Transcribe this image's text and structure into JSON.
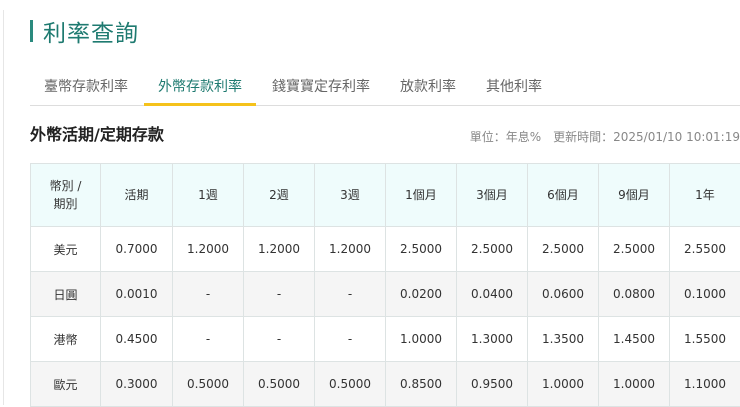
{
  "page_title": "利率查詢",
  "tabs": [
    {
      "label": "臺幣存款利率"
    },
    {
      "label": "外幣存款利率"
    },
    {
      "label": "錢寶寶定存利率"
    },
    {
      "label": "放款利率"
    },
    {
      "label": "其他利率"
    }
  ],
  "section_title": "外幣活期/定期存款",
  "unit": "單位：年息%",
  "updated": "更新時間：2025/01/10 10:01:19",
  "table": {
    "headers": [
      "幣別 / 期別",
      "活期",
      "1週",
      "2週",
      "3週",
      "1個月",
      "3個月",
      "6個月",
      "9個月",
      "1年"
    ],
    "rows": [
      [
        "美元",
        "0.7000",
        "1.2000",
        "1.2000",
        "1.2000",
        "2.5000",
        "2.5000",
        "2.5000",
        "2.5000",
        "2.5500"
      ],
      [
        "日圓",
        "0.0010",
        "-",
        "-",
        "-",
        "0.0200",
        "0.0400",
        "0.0600",
        "0.0800",
        "0.1000"
      ],
      [
        "港幣",
        "0.4500",
        "-",
        "-",
        "-",
        "1.0000",
        "1.3000",
        "1.3500",
        "1.4500",
        "1.5500"
      ],
      [
        "歐元",
        "0.3000",
        "0.5000",
        "0.5000",
        "0.5000",
        "0.8500",
        "0.9500",
        "1.0000",
        "1.0000",
        "1.1000"
      ]
    ]
  }
}
